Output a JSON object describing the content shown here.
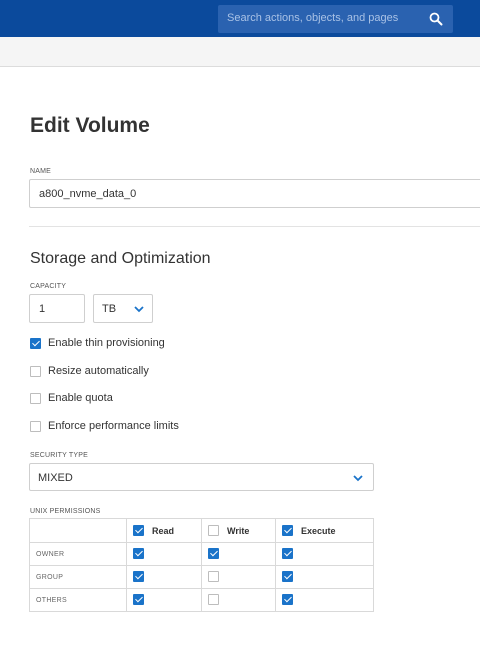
{
  "header": {
    "search_placeholder": "Search actions, objects, and pages"
  },
  "page": {
    "title": "Edit Volume"
  },
  "name_field": {
    "label": "NAME",
    "value": "a800_nvme_data_0"
  },
  "storage": {
    "section_title": "Storage and Optimization",
    "capacity_label": "CAPACITY",
    "capacity_value": "1",
    "capacity_unit": "TB",
    "options": [
      {
        "label": "Enable thin provisioning",
        "checked": true
      },
      {
        "label": "Resize automatically",
        "checked": false
      },
      {
        "label": "Enable quota",
        "checked": false
      },
      {
        "label": "Enforce performance limits",
        "checked": false
      }
    ]
  },
  "security": {
    "label": "SECURITY TYPE",
    "value": "MIXED"
  },
  "unix_permissions": {
    "label": "UNIX PERMISSIONS",
    "columns": [
      {
        "label": "Read",
        "checked": true
      },
      {
        "label": "Write",
        "checked": false
      },
      {
        "label": "Execute",
        "checked": true
      }
    ],
    "rows": [
      {
        "label": "OWNER",
        "read": true,
        "write": true,
        "execute": true
      },
      {
        "label": "GROUP",
        "read": true,
        "write": false,
        "execute": true
      },
      {
        "label": "OTHERS",
        "read": true,
        "write": false,
        "execute": true
      }
    ]
  },
  "colors": {
    "header_bg": "#0b4a9c",
    "accent": "#1a73c9"
  },
  "icons": {
    "search": "search-icon",
    "dropdown": "chevron-down-icon"
  }
}
